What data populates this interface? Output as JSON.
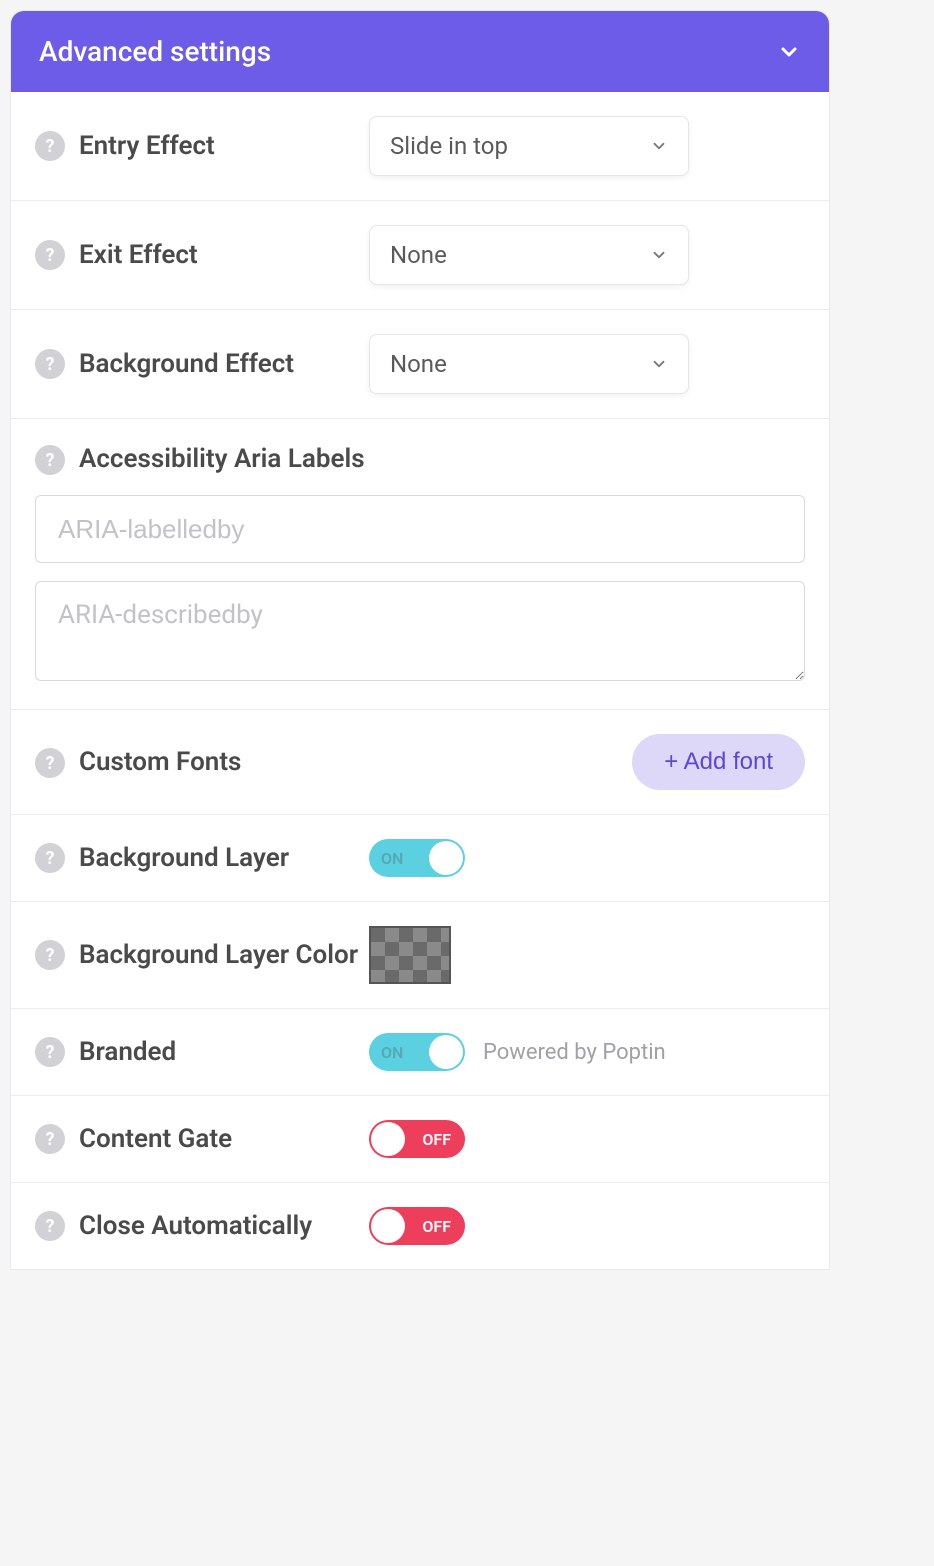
{
  "header": {
    "title": "Advanced settings"
  },
  "entryEffect": {
    "label": "Entry Effect",
    "value": "Slide in top"
  },
  "exitEffect": {
    "label": "Exit Effect",
    "value": "None"
  },
  "backgroundEffect": {
    "label": "Background Effect",
    "value": "None"
  },
  "accessibility": {
    "label": "Accessibility Aria Labels",
    "labelledbyPlaceholder": "ARIA-labelledby",
    "describedbyPlaceholder": "ARIA-describedby"
  },
  "customFonts": {
    "label": "Custom Fonts",
    "addButton": "+ Add font"
  },
  "backgroundLayer": {
    "label": "Background Layer",
    "state": "ON"
  },
  "backgroundLayerColor": {
    "label": "Background Layer Color"
  },
  "branded": {
    "label": "Branded",
    "state": "ON",
    "hint": "Powered by Poptin"
  },
  "contentGate": {
    "label": "Content Gate",
    "state": "OFF"
  },
  "closeAutomatically": {
    "label": "Close Automatically",
    "state": "OFF"
  }
}
